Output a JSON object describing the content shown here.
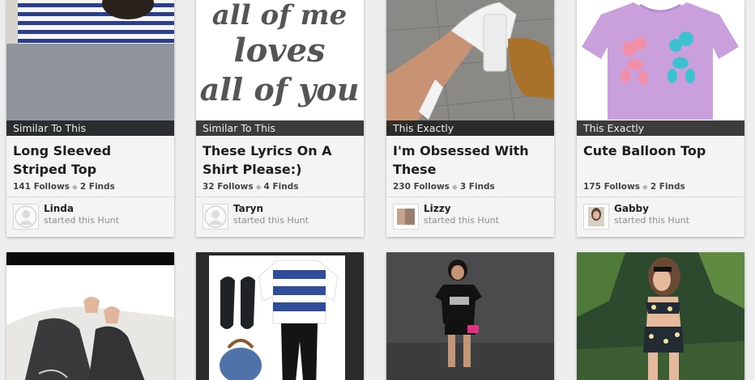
{
  "cards": [
    {
      "tag": "Similar To This",
      "title": "Long Sleeved Striped Top",
      "follows": "141 Follows",
      "finds": "2 Finds",
      "user": "Linda",
      "action": "started this Hunt",
      "avatar_icon": "default-user-icon"
    },
    {
      "tag": "Similar To This",
      "title": "These Lyrics On A Shirt Please:)",
      "follows": "32 Follows",
      "finds": "4 Finds",
      "user": "Taryn",
      "action": "started this Hunt",
      "avatar_icon": "default-user-icon"
    },
    {
      "tag": "This Exactly",
      "title": "I'm Obsessed With These",
      "follows": "230 Follows",
      "finds": "3 Finds",
      "user": "Lizzy",
      "action": "started this Hunt",
      "avatar_icon": "user-photo"
    },
    {
      "tag": "This Exactly",
      "title": "Cute Balloon Top",
      "follows": "175 Follows",
      "finds": "2 Finds",
      "user": "Gabby",
      "action": "started this Hunt",
      "avatar_icon": "user-photo"
    }
  ],
  "image_text": {
    "lyrics_line1": "all of me",
    "lyrics_line2": "loves",
    "lyrics_line3": "all of you"
  },
  "colors": {
    "page_bg": "#eeeeee",
    "card_bg": "#f4f4f4",
    "tag_bg": "#1c1c1c",
    "shirt_purple": "#c9a0dc"
  }
}
